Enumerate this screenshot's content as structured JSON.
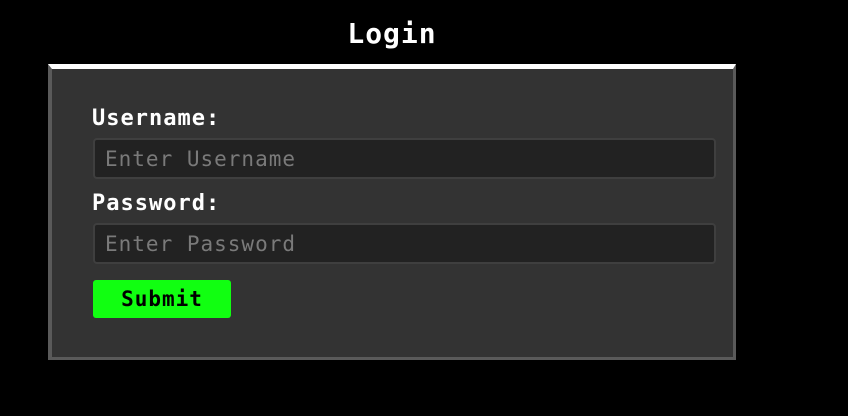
{
  "page": {
    "title": "Login"
  },
  "form": {
    "username_label": "Username:",
    "username_placeholder": "Enter Username",
    "username_value": "",
    "password_label": "Password:",
    "password_placeholder": "Enter Password",
    "password_value": "",
    "submit_label": "Submit"
  },
  "colors": {
    "background": "#000000",
    "panel": "#333333",
    "input_background": "#222222",
    "submit_button": "#11ff11",
    "text": "#ffffff"
  }
}
